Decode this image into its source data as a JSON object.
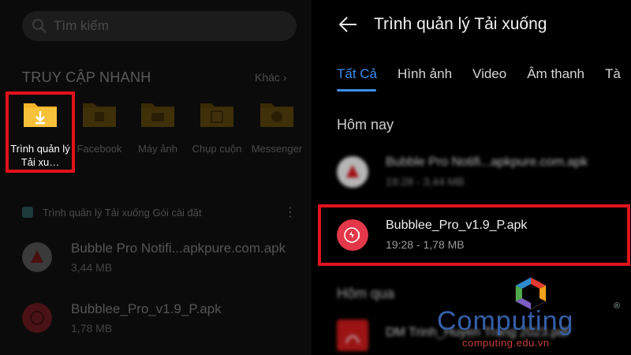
{
  "left": {
    "search": {
      "placeholder": "Tìm kiếm"
    },
    "quick_access": {
      "title": "TRUY CẬP NHANH",
      "more": "Khác",
      "items": [
        {
          "label": "Trình quản lý Tải xu…",
          "icon": "download-folder-icon"
        },
        {
          "label": "Facebook",
          "icon": "facebook-folder-icon"
        },
        {
          "label": "Máy ảnh",
          "icon": "camera-folder-icon"
        },
        {
          "label": "Chụp cuộn",
          "icon": "screenshot-folder-icon"
        },
        {
          "label": "Messenger",
          "icon": "messenger-folder-icon"
        }
      ]
    },
    "section": {
      "label": "Trình quản lý Tải xuống Gói cài đặt"
    },
    "files": [
      {
        "name": "Bubble Pro Notifi...apkpure.com.apk",
        "size": "3,44 MB"
      },
      {
        "name": "Bubblee_Pro_v1.9_P.apk",
        "size": "1,78 MB"
      }
    ]
  },
  "right": {
    "title": "Trình quản lý Tải xuống",
    "tabs": [
      "Tất Cả",
      "Hình ảnh",
      "Video",
      "Âm thanh",
      "Tà"
    ],
    "groups": [
      {
        "label": "Hôm nay",
        "files": [
          {
            "name": "Bubble Pro Notifi...apkpure.com.apk",
            "meta": "19:28 - 3,44 MB"
          },
          {
            "name": "Bubblee_Pro_v1.9_P.apk",
            "meta": "19:28 - 1,78 MB"
          }
        ]
      },
      {
        "label": "Hôm qua",
        "files": [
          {
            "name": "DM Trinh_Huyen Trang 2023.pdf",
            "meta": ""
          }
        ]
      }
    ]
  },
  "watermark": {
    "brand": "Computing",
    "site": "computing.edu.vn",
    "reg": "®"
  },
  "colors": {
    "accent": "#3b8eea",
    "highlight": "#e2121b",
    "folder": "#f3b52a"
  }
}
